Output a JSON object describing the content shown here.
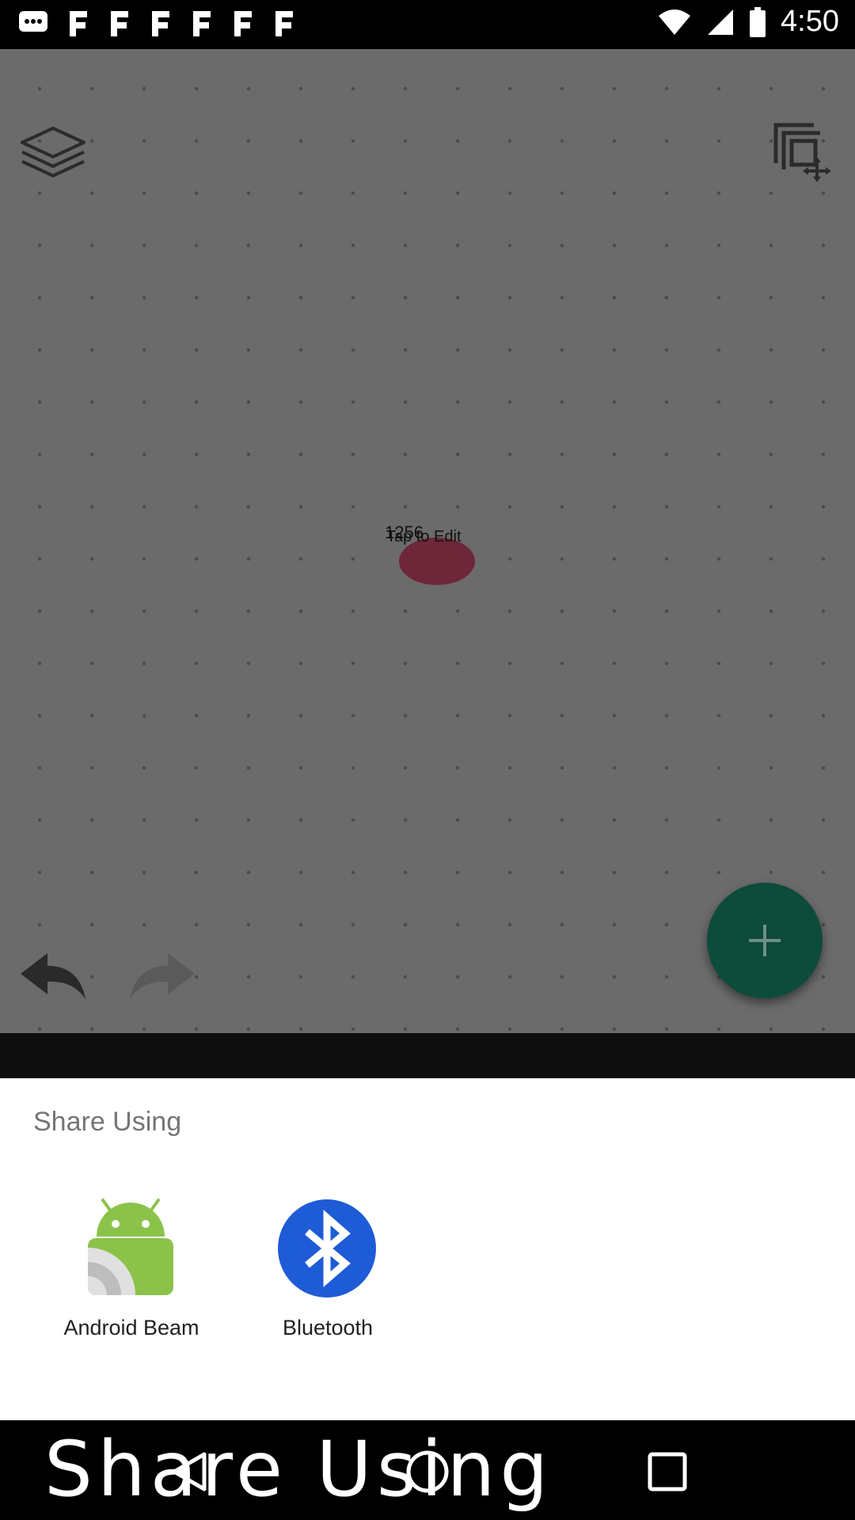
{
  "status_bar": {
    "time": "4:50",
    "left_icons": [
      "notification-icon",
      "app-icon",
      "app-icon",
      "app-icon",
      "app-icon",
      "app-icon",
      "app-icon"
    ],
    "right_icons": [
      "wifi-icon",
      "signal-icon",
      "battery-icon"
    ]
  },
  "canvas": {
    "node_number": "1256",
    "node_label": "Tap to Edit",
    "node_color": "#6e2639",
    "fab_color": "#0d4b3a"
  },
  "share_sheet": {
    "title": "Share Using",
    "options": [
      {
        "label": "Android Beam",
        "icon": "android-beam-icon"
      },
      {
        "label": "Bluetooth",
        "icon": "bluetooth-icon"
      }
    ]
  },
  "nav_bar": {
    "overlay_text": "Share Using"
  }
}
